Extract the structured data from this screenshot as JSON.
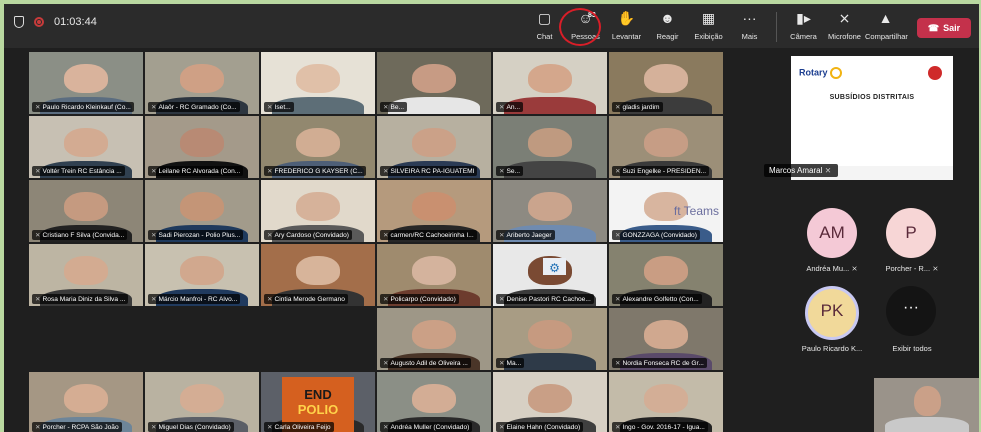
{
  "header": {
    "timer": "01:03:44",
    "participant_count": "83",
    "items": [
      {
        "label": "Chat",
        "icon": "chat-icon"
      },
      {
        "label": "Pessoas",
        "icon": "people-icon"
      },
      {
        "label": "Levantar",
        "icon": "raise-hand-icon"
      },
      {
        "label": "Reagir",
        "icon": "react-icon"
      },
      {
        "label": "Exibição",
        "icon": "view-icon"
      },
      {
        "label": "Mais",
        "icon": "more-icon"
      },
      {
        "label": "Câmera",
        "icon": "camera-icon"
      },
      {
        "label": "Microfone",
        "icon": "microphone-muted-icon"
      },
      {
        "label": "Compartilhar",
        "icon": "share-icon"
      }
    ],
    "leave_label": "Sair",
    "colors": {
      "leave": "#c4314b",
      "highlight_circle": "#d91e28"
    }
  },
  "tiles": [
    {
      "name": "Paulo Ricardo Kleinkauf (Co..."
    },
    {
      "name": "Alaôr - RC Gramado (Co..."
    },
    {
      "name": "Iset..."
    },
    {
      "name": "Be..."
    },
    {
      "name": "An..."
    },
    {
      "name": "gladis jardim"
    },
    {
      "name": "SILVEIRA RC PA-IGUATEMI"
    },
    {
      "name": "Se..."
    },
    {
      "name": "Suzi Engelke - PRESIDEN..."
    },
    {
      "name": "Voltér Trein RC Estância ..."
    },
    {
      "name": "Leilane RC Alvorada (Con..."
    },
    {
      "name": "FREDERICO G KAYSER (C..."
    },
    {
      "name": "carmen/RC Cachoeirinha I..."
    },
    {
      "name": "Ariberto Jaeger"
    },
    {
      "name": "GONZZAGA (Convidado)"
    },
    {
      "name": "Cristiano F Silva (Convida..."
    },
    {
      "name": "Sadi Pierozan - Polio Plus..."
    },
    {
      "name": "Ary Cardoso (Convidado)"
    },
    {
      "name": "Policarpo (Convidado)"
    },
    {
      "name": "Denise Pastori RC Cachoe..."
    },
    {
      "name": "Alexandre Golfetto (Con..."
    },
    {
      "name": "Rosa Maria Diniz da Silva ..."
    },
    {
      "name": "Márcio Manfroi - RC Alvo..."
    },
    {
      "name": "Cintia Merode Germano"
    },
    {
      "name": "Augusto Adil de Oliveira ..."
    },
    {
      "name": "Ma..."
    },
    {
      "name": "Nordia Fonseca RC de Gr..."
    },
    {
      "name": "Porcher - RCPA São João"
    },
    {
      "name": "Miguel Dias (Convidado)"
    },
    {
      "name": "Carla Oliveira Feijo"
    },
    {
      "name": "Andréa Muller (Convidado)"
    },
    {
      "name": "Elaine Hahn (Convidado)"
    },
    {
      "name": "Ingo - Gov. 2016-17 - Igua..."
    }
  ],
  "tile_texts": {
    "teams_watermark": "ft Teams",
    "banner_top": "",
    "banner_end": "END",
    "banner_polio": "POLIO"
  },
  "shared_content": {
    "presenter": "Marcos Amaral",
    "logo_rotary": "Rotary",
    "logo_district": "",
    "title": "SUBSÍDIOS DISTRITAIS",
    "subtitle": "",
    "subtitle2": "",
    "lines": []
  },
  "roster": [
    {
      "initials": "AM",
      "name": "Andréa Mu...",
      "bg": "#f4c9d6"
    },
    {
      "initials": "P",
      "name": "Porcher - R...",
      "bg": "#f7d6d6"
    },
    {
      "initials": "PK",
      "name": "Paulo Ricardo K...",
      "bg": "#f1d99a"
    },
    {
      "initials": "···",
      "name": "Exibir todos",
      "bg": "#141414"
    }
  ]
}
